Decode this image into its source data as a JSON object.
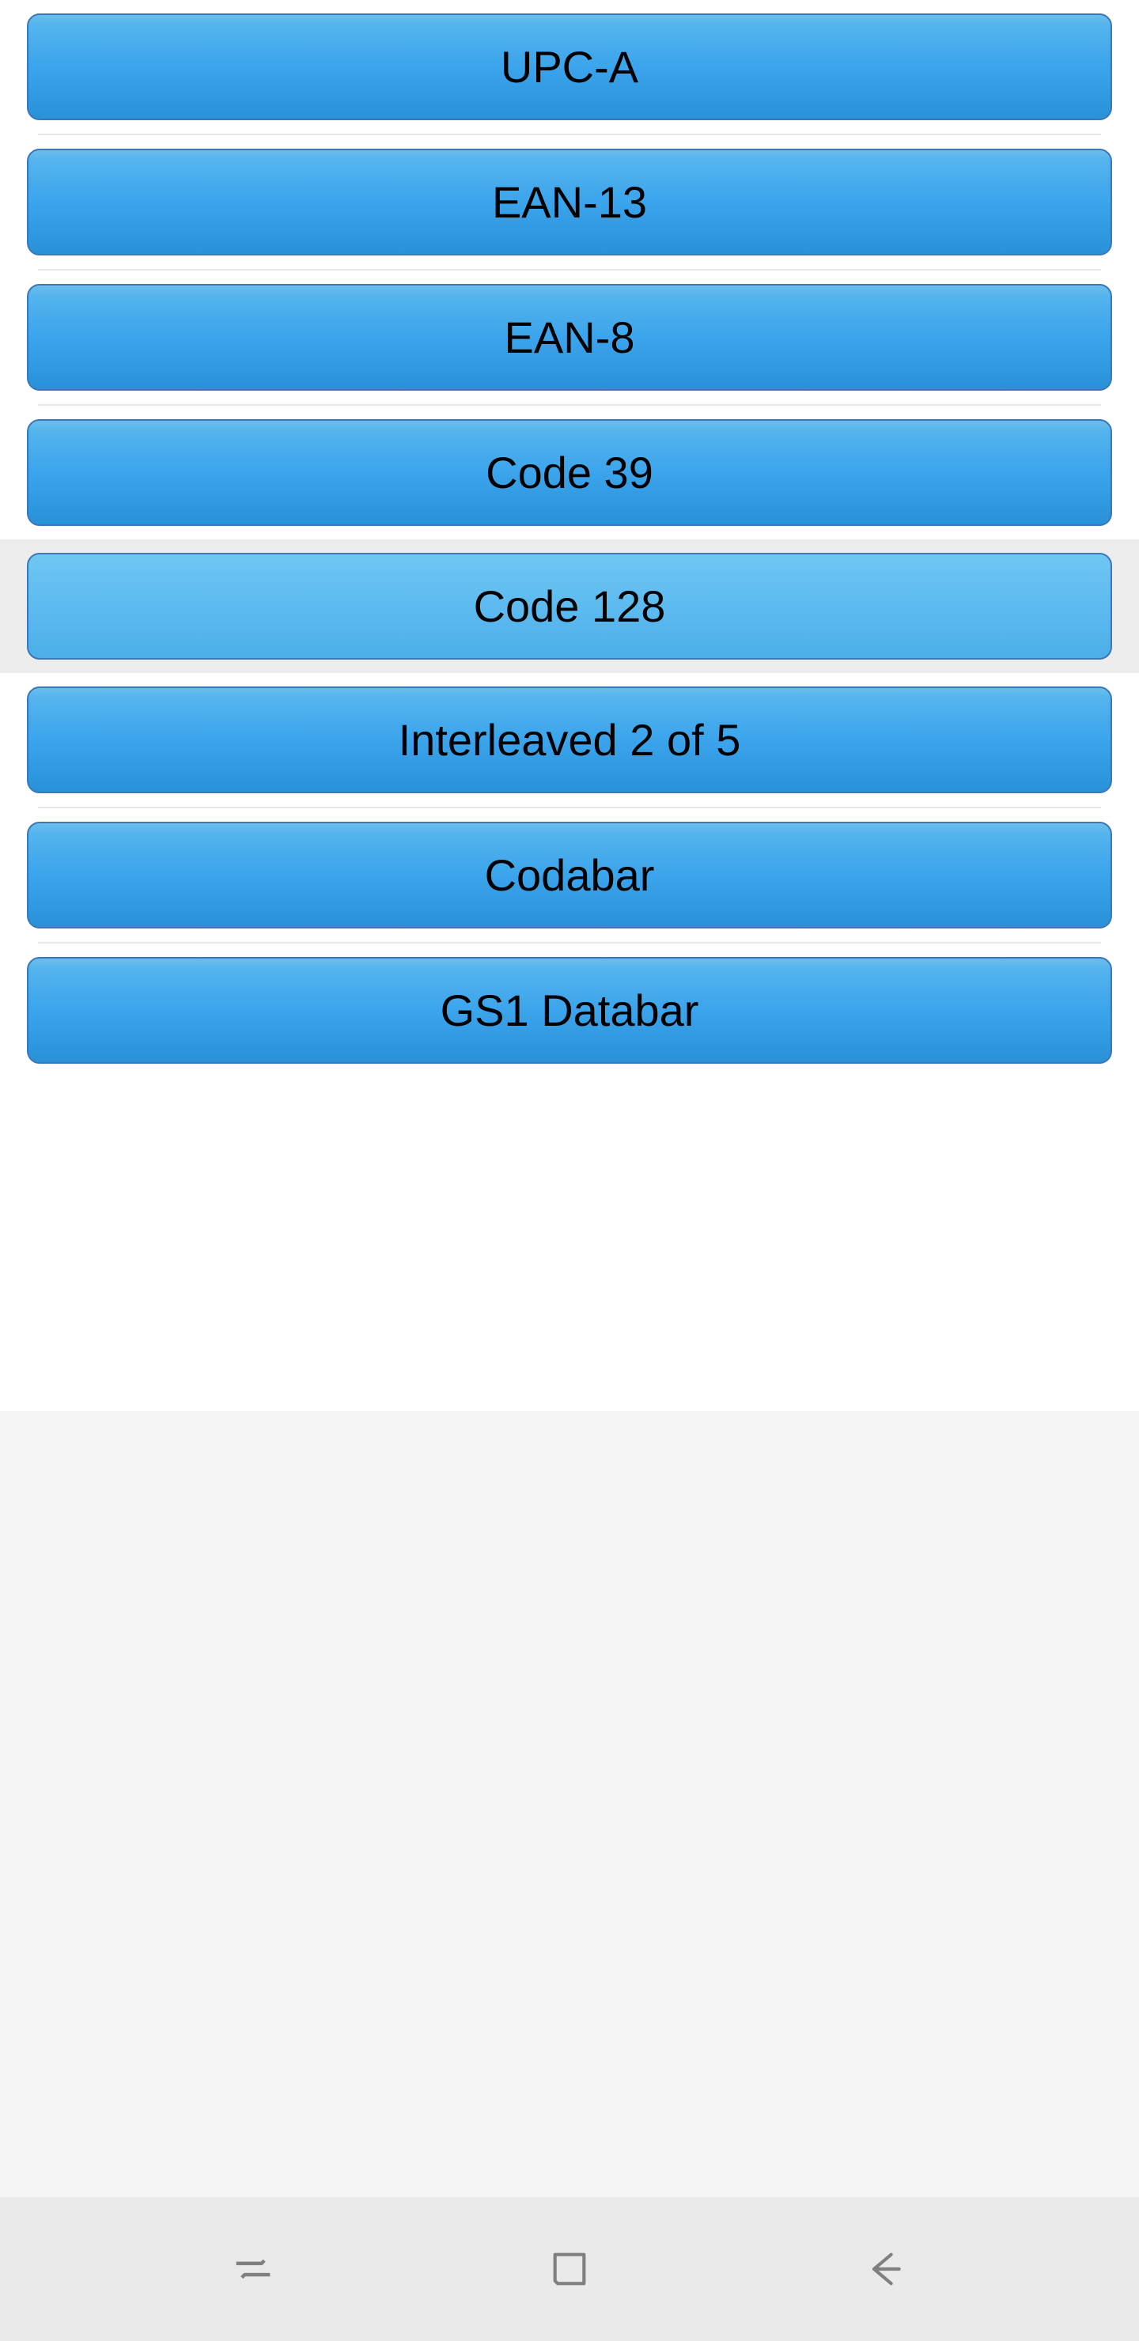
{
  "buttons": [
    {
      "label": "UPC-A",
      "selected": false
    },
    {
      "label": "EAN-13",
      "selected": false
    },
    {
      "label": "EAN-8",
      "selected": false
    },
    {
      "label": "Code 39",
      "selected": false
    },
    {
      "label": "Code 128",
      "selected": true
    },
    {
      "label": "Interleaved 2 of 5",
      "selected": false
    },
    {
      "label": "Codabar",
      "selected": false
    },
    {
      "label": "GS1 Databar",
      "selected": false
    }
  ]
}
